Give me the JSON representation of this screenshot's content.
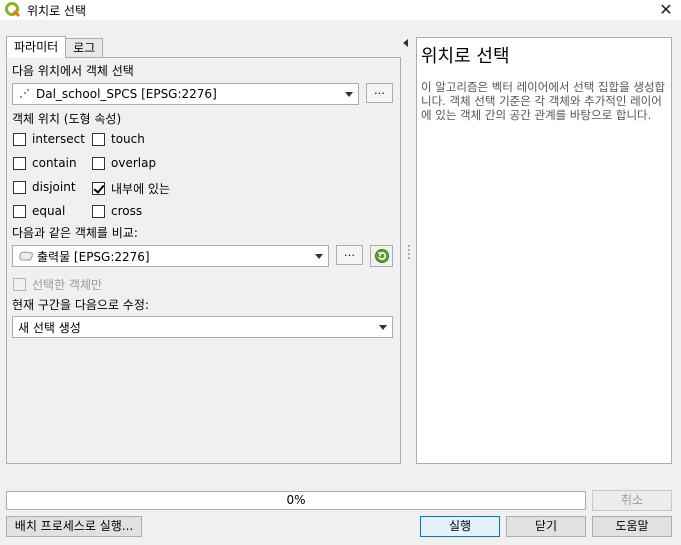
{
  "window": {
    "title": "위치로 선택"
  },
  "tabs": [
    {
      "label": "파라미터"
    },
    {
      "label": "로그"
    }
  ],
  "params": {
    "select_features_from_label": "다음 위치에서 객체 선택",
    "source_layer": "Dal_school_SPCS [EPSG:2276]",
    "browse_label": "…",
    "predicate_label": "객체 위치 (도형 속성)",
    "predicates": [
      {
        "label": "intersect",
        "checked": false
      },
      {
        "label": "touch",
        "checked": false
      },
      {
        "label": "contain",
        "checked": false
      },
      {
        "label": "overlap",
        "checked": false
      },
      {
        "label": "disjoint",
        "checked": false
      },
      {
        "label": "내부에 있는",
        "checked": true
      },
      {
        "label": "equal",
        "checked": false
      },
      {
        "label": "cross",
        "checked": false
      }
    ],
    "compare_label": "다음과 같은 객체를 비교:",
    "compare_layer": "출력물 [EPSG:2276]",
    "selected_only_label": "선택한 객체만",
    "modify_label": "현재 구간을 다음으로 수정:",
    "modify_value": "새 선택 생성"
  },
  "help": {
    "title": "위치로 선택",
    "body": "이 알고리즘은 벡터 레이어에서 선택 집합을 생성합니다. 객체 선택 기준은 각 객체와 추가적인 레이어에 있는 객체 간의 공간 관계를 바탕으로 합니다."
  },
  "progress": {
    "text": "0%",
    "value": 0
  },
  "buttons": {
    "cancel": "취소",
    "batch": "배치 프로세스로 실행...",
    "run": "실행",
    "close": "닫기",
    "help": "도움말"
  },
  "icons": {
    "app": "qgis-icon",
    "point_layer": "point-layer-icon",
    "polygon_layer": "polygon-layer-icon",
    "iterate": "iterate-icon"
  }
}
